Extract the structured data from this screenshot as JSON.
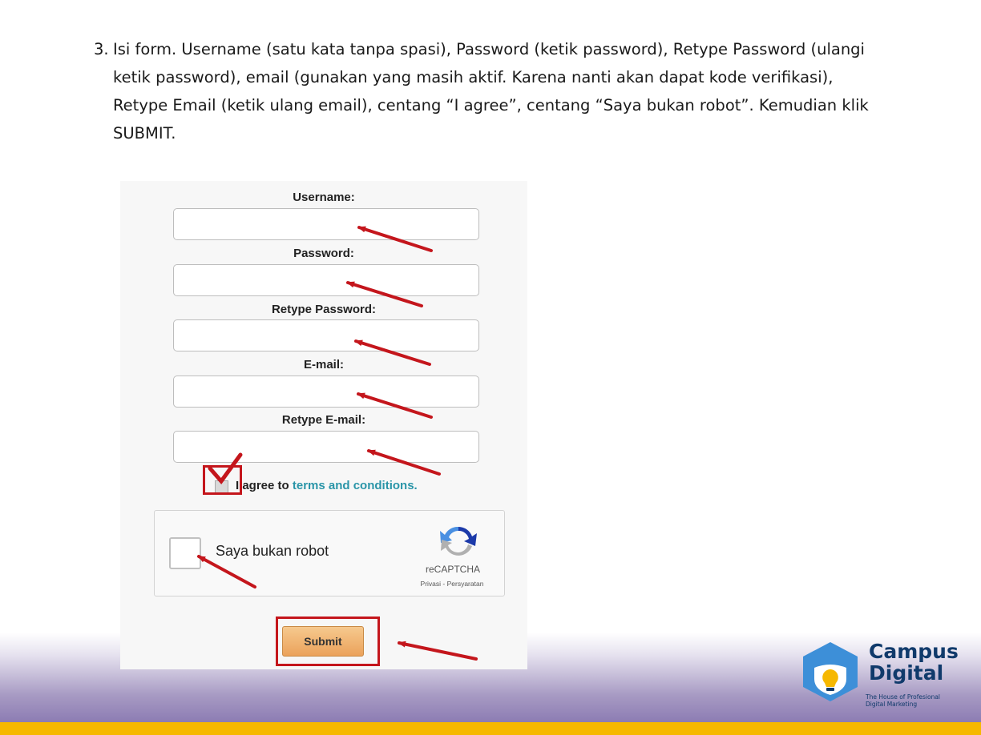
{
  "instruction": {
    "number": "3.",
    "text": "Isi form. Username (satu kata tanpa spasi), Password (ketik password), Retype Password (ulangi ketik password), email (gunakan yang masih aktif. Karena nanti akan dapat kode verifikasi), Retype Email (ketik ulang email), centang “I agree”, centang “Saya bukan robot”. Kemudian klik SUBMIT."
  },
  "form": {
    "username_label": "Username:",
    "password_label": "Password:",
    "retype_password_label": "Retype Password:",
    "email_label": "E-mail:",
    "retype_email_label": "Retype E-mail:",
    "username_value": "",
    "password_value": "",
    "retype_password_value": "",
    "email_value": "",
    "retype_email_value": "",
    "agree_prefix": "I agree to",
    "terms_link": "terms and conditions.",
    "agree_checked": true,
    "submit_label": "Submit"
  },
  "recaptcha": {
    "label": "Saya bukan robot",
    "brand": "reCAPTCHA",
    "links": "Privasi - Persyaratan",
    "checked": false
  },
  "logo": {
    "name_line1": "Campus",
    "name_line2": "Digital",
    "tagline_line1": "The House of Profesional",
    "tagline_line2": "Digital Marketing"
  },
  "colors": {
    "annotation_red": "#c4161c",
    "link_teal": "#2a95a8",
    "brand_navy": "#103a6b",
    "accent_yellow": "#f6b800",
    "band_purple": "#8c7cb3",
    "submit_orange": "#eba25b"
  },
  "icons": {
    "recaptcha_logo": "recaptcha-logo-icon",
    "brand_logo": "lightbulb-hexagon-icon"
  }
}
